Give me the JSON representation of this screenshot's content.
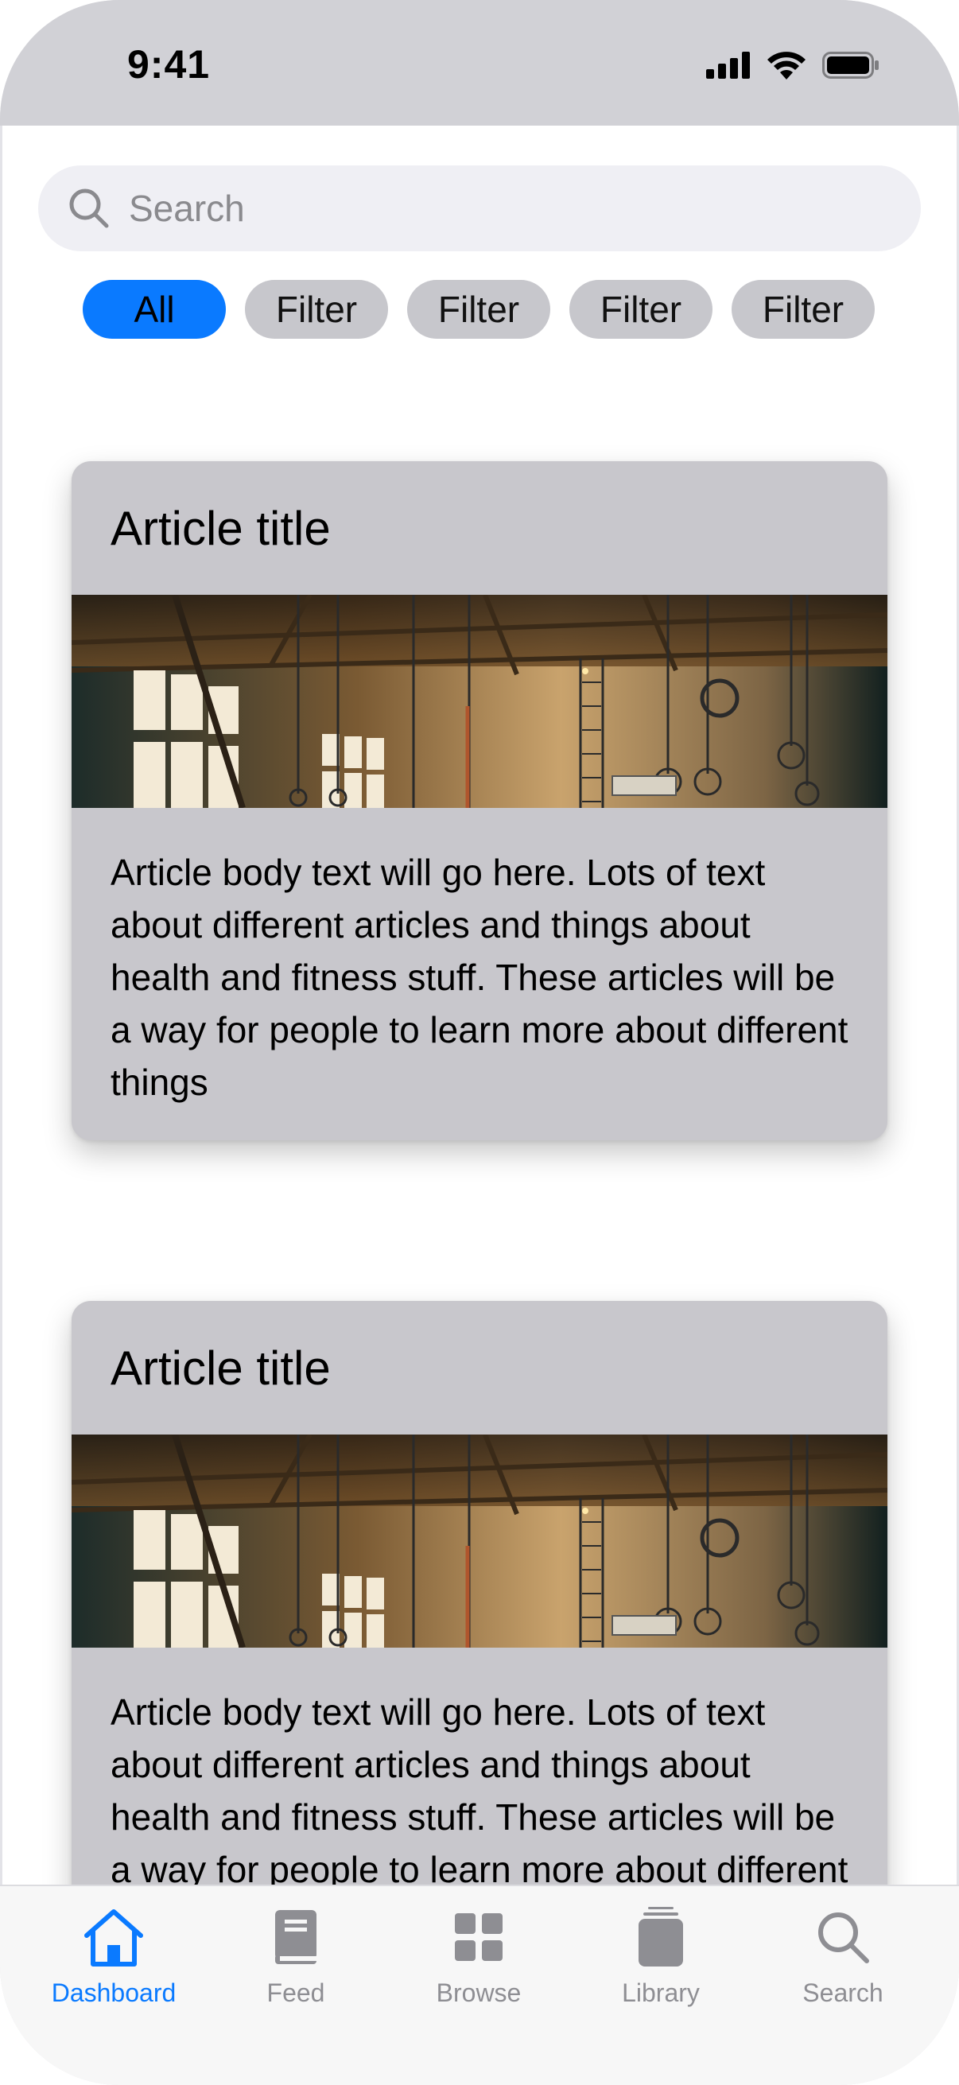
{
  "status_bar": {
    "time": "9:41"
  },
  "search": {
    "placeholder": "Search"
  },
  "filters": [
    {
      "label": "All",
      "active": true
    },
    {
      "label": "Filter",
      "active": false
    },
    {
      "label": "Filter",
      "active": false
    },
    {
      "label": "Filter",
      "active": false
    },
    {
      "label": "Filter",
      "active": false
    }
  ],
  "articles": [
    {
      "title": "Article title",
      "body": "Article body text will go here. Lots of text about different articles and things about health and fitness stuff. These articles will be a way for people to learn more about different things"
    },
    {
      "title": "Article title",
      "body": "Article body text will go here. Lots of text about different articles and things about health and fitness stuff. These articles will be a way for people to learn more about different things"
    }
  ],
  "tab_bar": {
    "items": [
      {
        "label": "Dashboard",
        "icon": "home-icon",
        "active": true
      },
      {
        "label": "Feed",
        "icon": "book-icon",
        "active": false
      },
      {
        "label": "Browse",
        "icon": "grid-icon",
        "active": false
      },
      {
        "label": "Library",
        "icon": "stack-icon",
        "active": false
      },
      {
        "label": "Search",
        "icon": "search-icon",
        "active": false
      }
    ]
  },
  "colors": {
    "accent": "#0a7aff",
    "chip": "#c7c7cc",
    "card": "#c8c7cc",
    "status_bar": "#d1d1d6"
  }
}
